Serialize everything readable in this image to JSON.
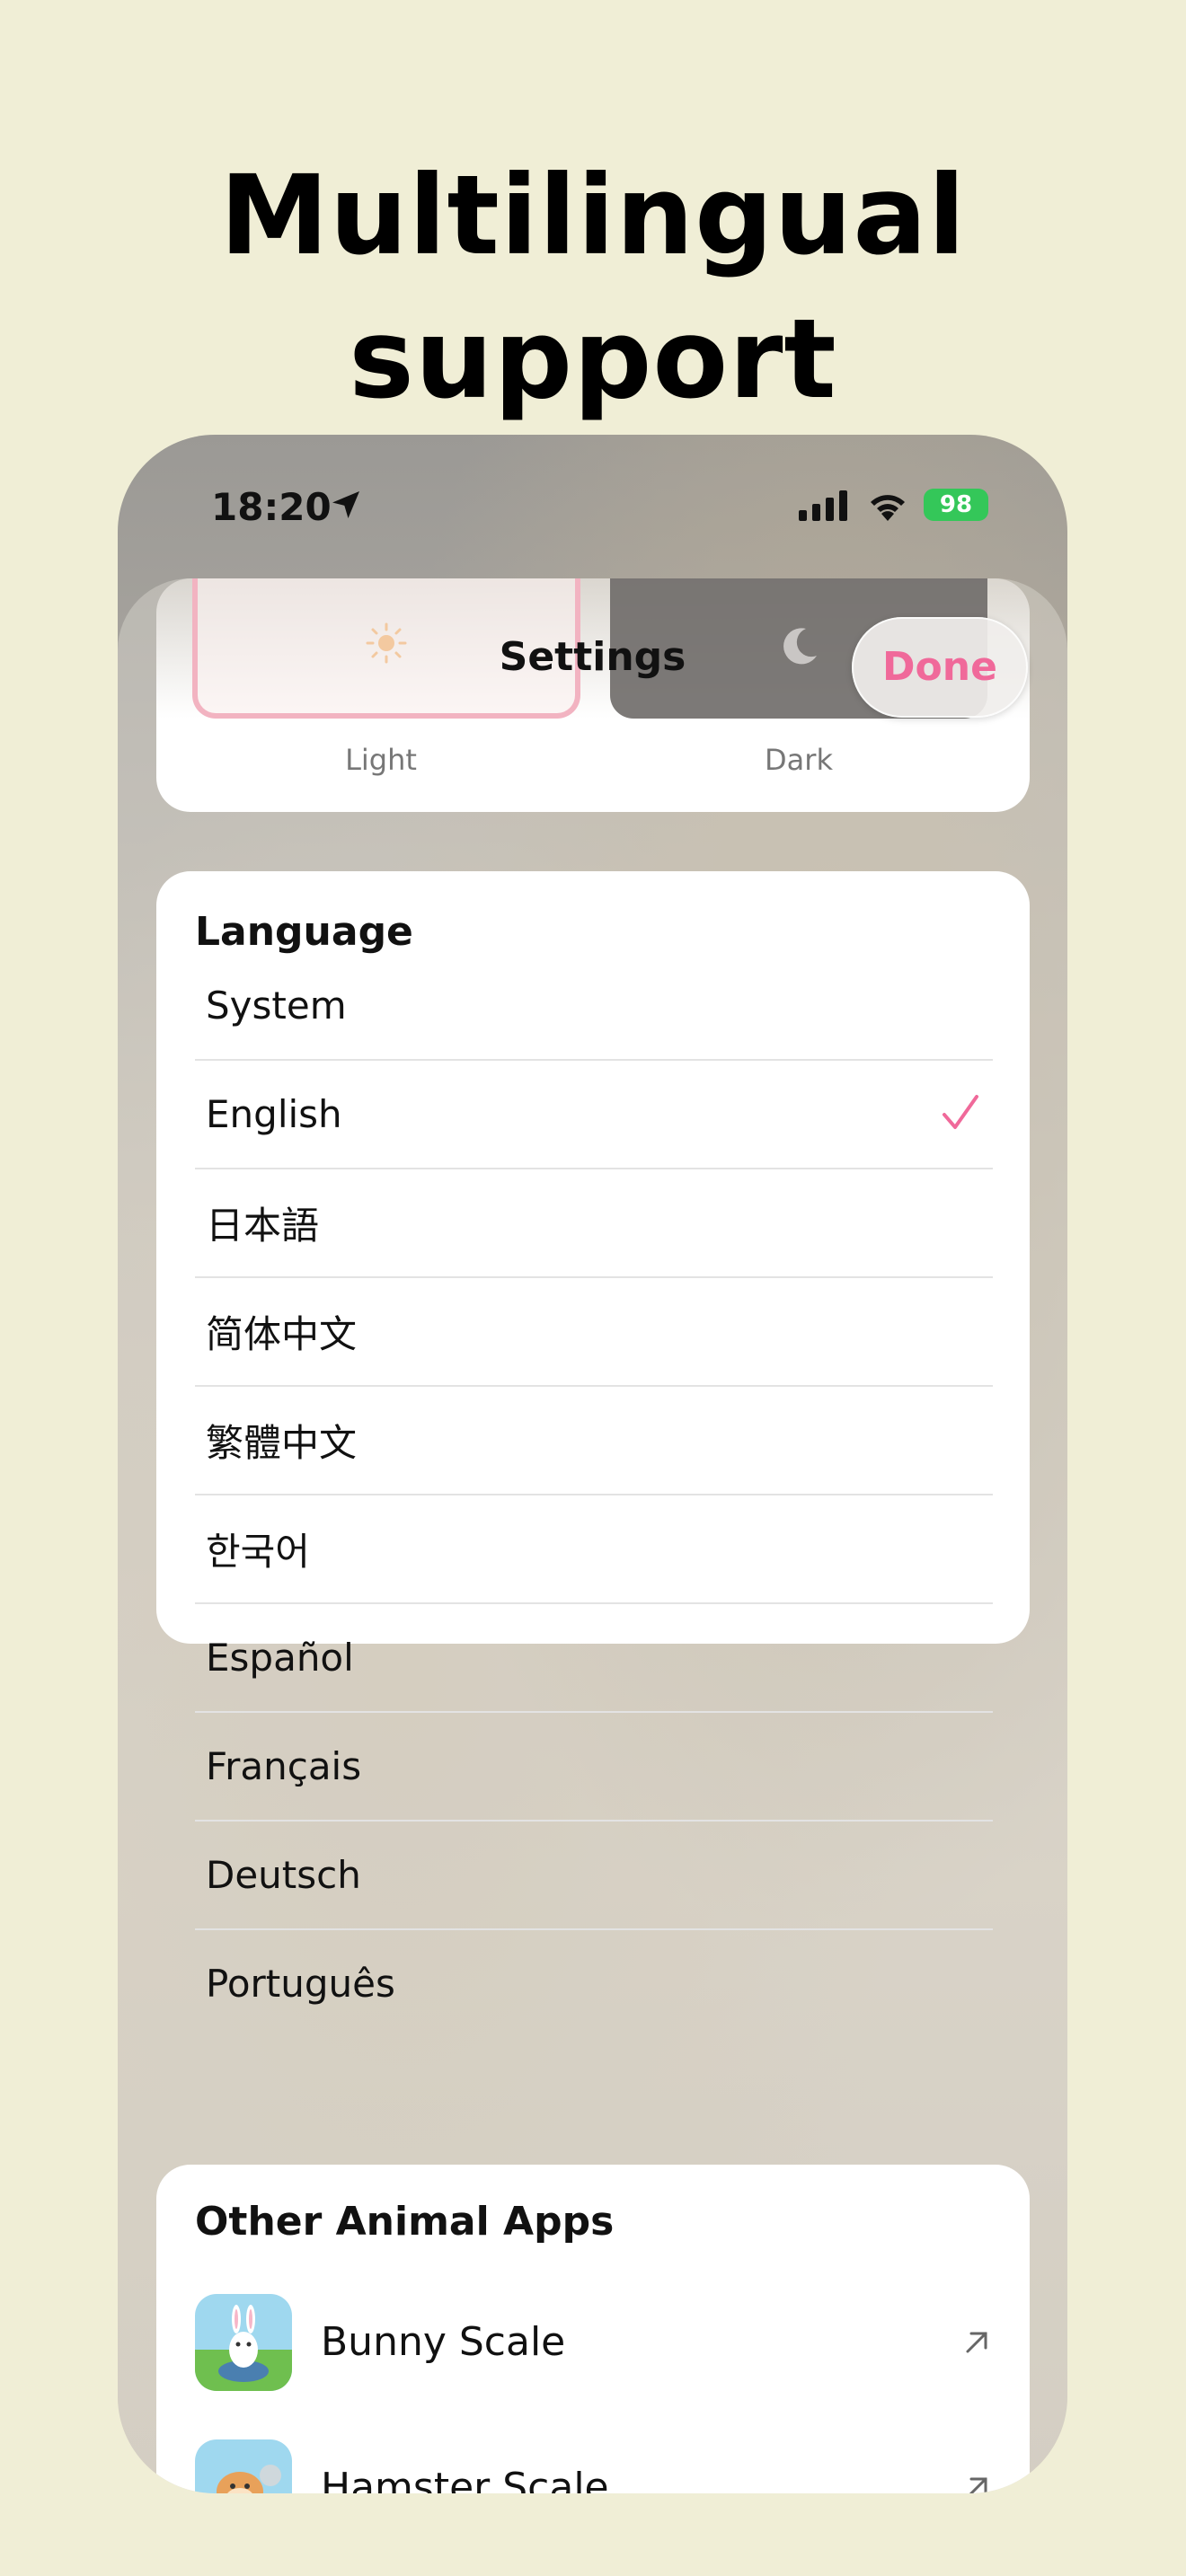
{
  "headline": "Multilingual support",
  "status_bar": {
    "time": "18:20",
    "battery": "98",
    "icons": [
      "location-arrow-icon",
      "cellular-signal-icon",
      "wifi-icon",
      "battery-charging-icon"
    ]
  },
  "nav": {
    "title": "Settings",
    "done_label": "Done"
  },
  "theme": {
    "light_label": "Light",
    "dark_label": "Dark",
    "selected": "Light"
  },
  "language": {
    "title": "Language",
    "items": [
      {
        "label": "System"
      },
      {
        "label": "English"
      },
      {
        "label": "日本語"
      },
      {
        "label": "简体中文"
      },
      {
        "label": "繁體中文"
      },
      {
        "label": "한국어"
      },
      {
        "label": "Español"
      },
      {
        "label": "Français"
      },
      {
        "label": "Deutsch"
      },
      {
        "label": "Português"
      }
    ],
    "selected": "English"
  },
  "other_apps": {
    "title": "Other Animal Apps",
    "items": [
      {
        "name": "Bunny Scale",
        "icon": "bunny-app-icon"
      },
      {
        "name": "Hamster Scale",
        "icon": "hamster-app-icon"
      }
    ]
  },
  "colors": {
    "background": "#f0eed6",
    "accent": "#f0699a",
    "battery": "#34c759"
  }
}
